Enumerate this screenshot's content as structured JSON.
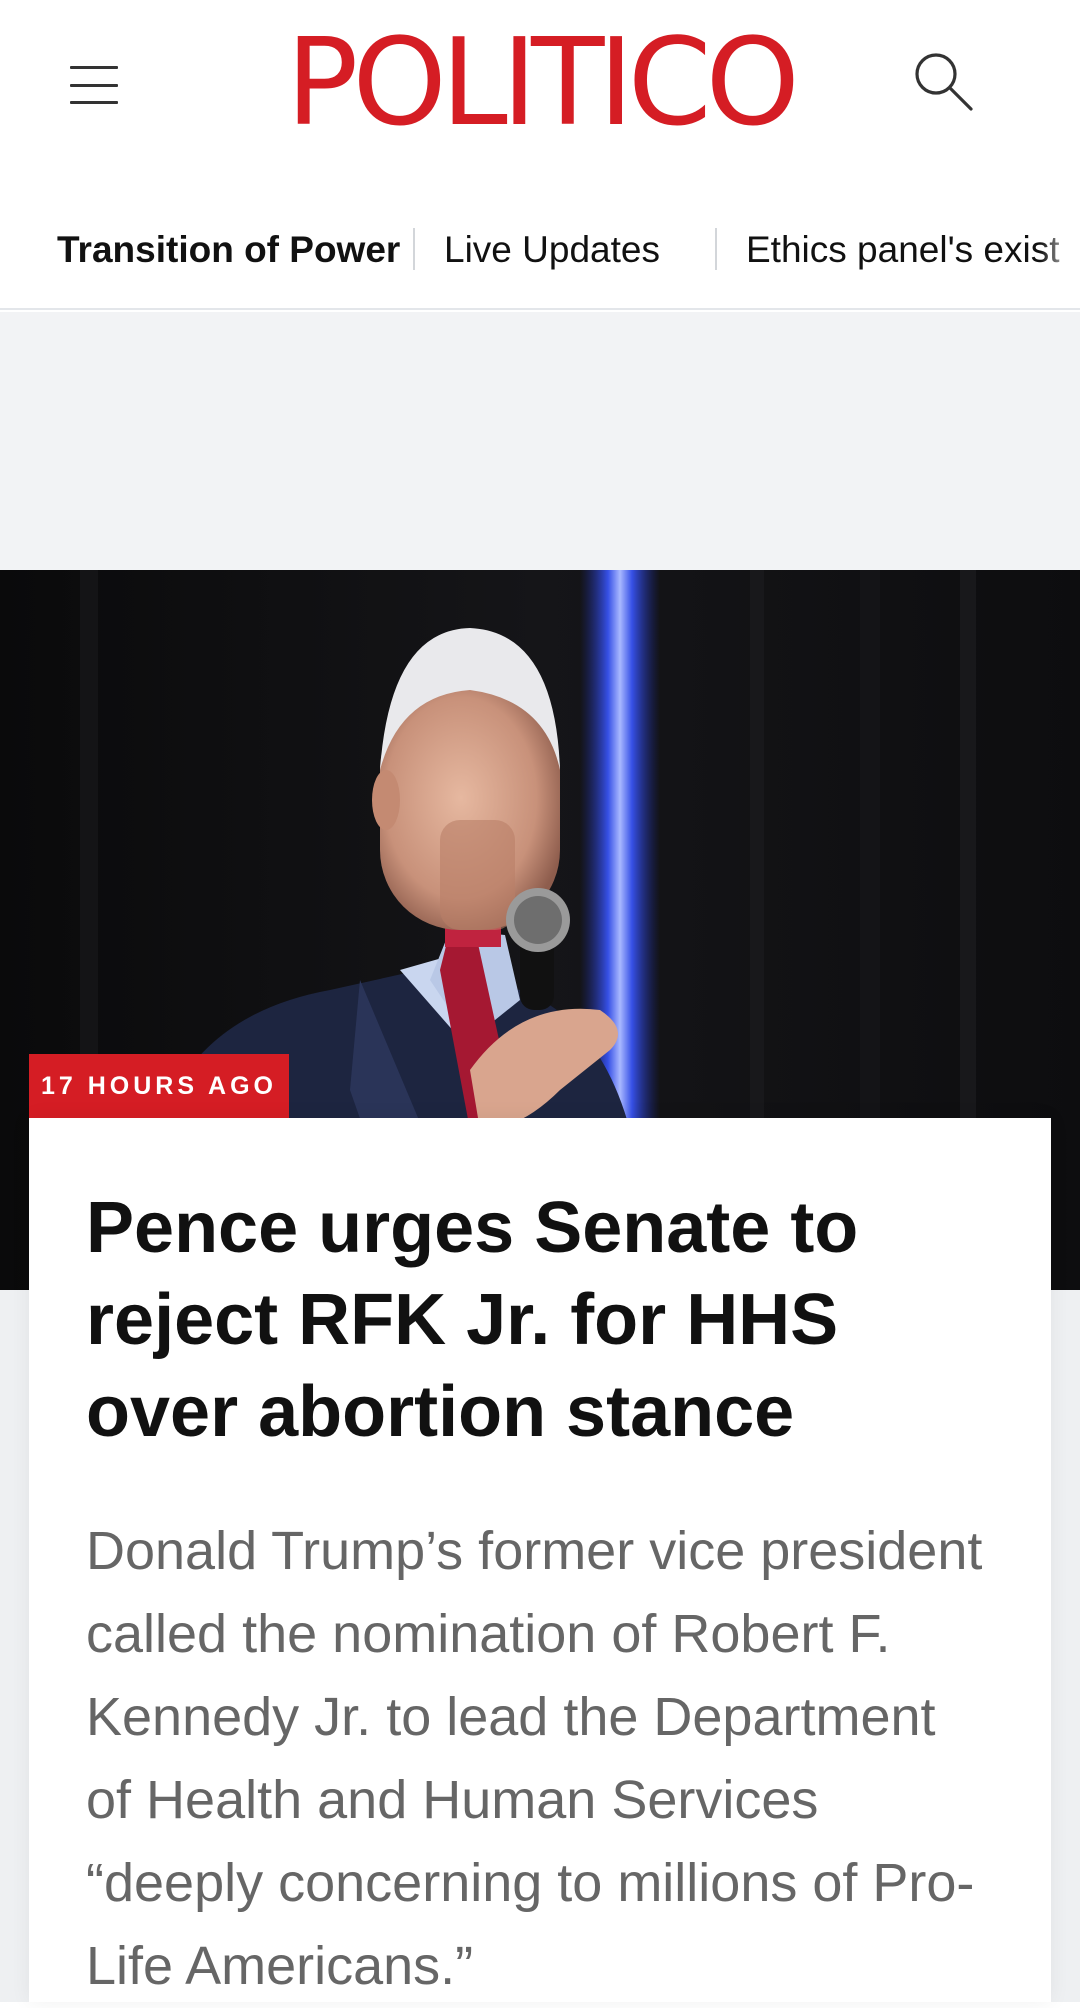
{
  "header": {
    "logo_text": "POLITICO",
    "logo_color": "#d51d24"
  },
  "nav": {
    "items": [
      {
        "label": "Transition of Power"
      },
      {
        "label": "Live Updates"
      },
      {
        "label": "Ethics panel's exist"
      }
    ]
  },
  "article": {
    "timestamp": "17 HOURS AGO",
    "headline_parts": {
      "p1": "Pence",
      "p2": " urges Senate to ",
      "p3": "reject RFK Jr.",
      "p4": " for HHS over abortion stance"
    },
    "dek": "Donald Trump’s former vice president called the nomination of Robert F. Kennedy Jr. to lead the Department of Health and Human Services “deeply concerning to millions of Pro-Life Americans.”"
  },
  "colors": {
    "accent": "#d51d24",
    "hero_background": "#0c0c0e",
    "ad_background": "#f2f3f5"
  }
}
